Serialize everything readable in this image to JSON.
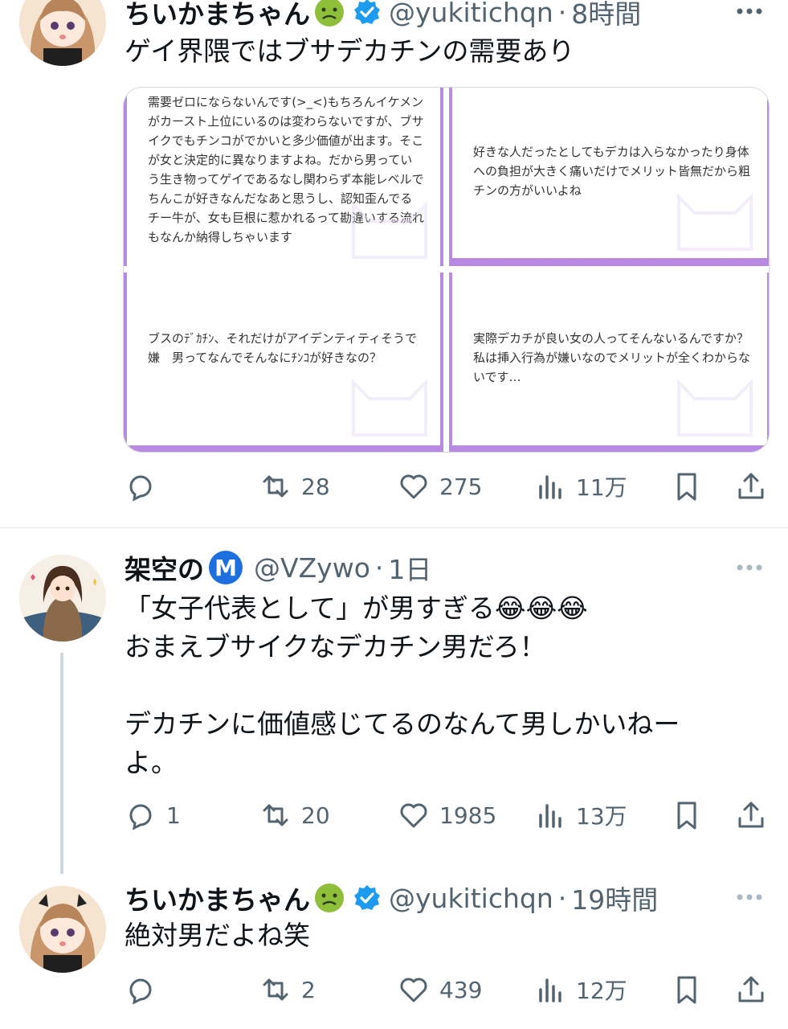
{
  "tweets": [
    {
      "name": "ちいかまちゃん",
      "handle": "@yukitichqn",
      "time": "8時間",
      "text": "ゲイ界隈ではブサデカチンの需要あり",
      "cards": [
        "需要ゼロにならないんです(>_<)もちろんイケメンがカースト上位にいるのは変わらないですが、ブサイクでもチンコがでかいと多少価値が出ます。そこが女と決定的に異なりますよね。だから男っていう生き物ってゲイであるなし関わらず本能レベルでちんこが好きなんだなあと思うし、認知歪んでるチー牛が、女も巨根に惹かれるって勘違いする流れもなんか納得しちゃいます",
        "好きな人だったとしてもデカは入らなかったり身体への負担が大きく痛いだけでメリット皆無だから粗チンの方がいいよね",
        "ブスのﾃﾞｶﾁﾝ、それだけがアイデンティティそうで嫌　男ってなんでそんなにﾁﾝｺが好きなの？",
        "実際デカチが良い女の人ってそんないるんですか？私は挿入行為が嫌いなのでメリットが全くわからないです…"
      ],
      "replies": "",
      "retweets": "28",
      "likes": "275",
      "views": "11万"
    },
    {
      "name": "架空の",
      "handle": "@VZywo",
      "time": "1日",
      "badge": "M",
      "text_lines": [
        "「女子代表として」が男すぎる😂😂😂",
        "おまえブサイクなデカチン男だろ！",
        "",
        "デカチンに価値感じてるのなんて男しかいねー",
        "よ。"
      ],
      "replies": "1",
      "retweets": "20",
      "likes": "1985",
      "views": "13万"
    },
    {
      "name": "ちいかまちゃん",
      "handle": "@yukitichqn",
      "time": "19時間",
      "text": "絶対男だよね笑",
      "replies": "",
      "retweets": "2",
      "likes": "439",
      "views": "12万"
    }
  ],
  "separator": "·",
  "colors": {
    "accent": "#1d9bf0",
    "muted": "#536471",
    "card_purple": "#b88ae2"
  }
}
